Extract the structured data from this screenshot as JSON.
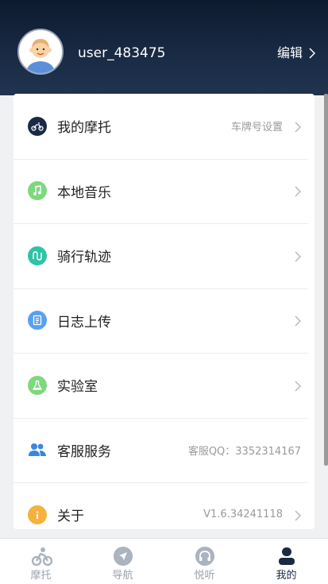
{
  "profile": {
    "username": "user_483475",
    "edit_label": "编辑"
  },
  "menu": [
    {
      "label": "我的摩托",
      "value": "车牌号设置",
      "icon": "motorbike-icon",
      "color": "#1b2a44",
      "chevron": true
    },
    {
      "label": "本地音乐",
      "value": "",
      "icon": "music-note-icon",
      "color": "#7ed87e",
      "chevron": true
    },
    {
      "label": "骑行轨迹",
      "value": "",
      "icon": "route-icon",
      "color": "#2ec4a6",
      "chevron": true
    },
    {
      "label": "日志上传",
      "value": "",
      "icon": "log-icon",
      "color": "#5aa0f0",
      "chevron": true
    },
    {
      "label": "实验室",
      "value": "",
      "icon": "lab-flask-icon",
      "color": "#7ed87e",
      "chevron": true
    },
    {
      "label": "客服服务",
      "value": "客服QQ：3352314167",
      "icon": "customer-service-icon",
      "color": "#3a86e0",
      "chevron": false
    },
    {
      "label": "关于",
      "value": "V1.6.34241118",
      "icon": "info-icon",
      "color": "#f5b23c",
      "chevron": true
    }
  ],
  "tabs": [
    {
      "label": "摩托",
      "icon": "motorbike-rider-icon",
      "active": false
    },
    {
      "label": "导航",
      "icon": "navigation-icon",
      "active": false
    },
    {
      "label": "悦听",
      "icon": "headphones-icon",
      "active": false
    },
    {
      "label": "我的",
      "icon": "person-icon",
      "active": true
    }
  ],
  "colors": {
    "header": "#1a2b45",
    "accent": "#1b2a44",
    "inactive_tab": "#9aa2ad"
  }
}
